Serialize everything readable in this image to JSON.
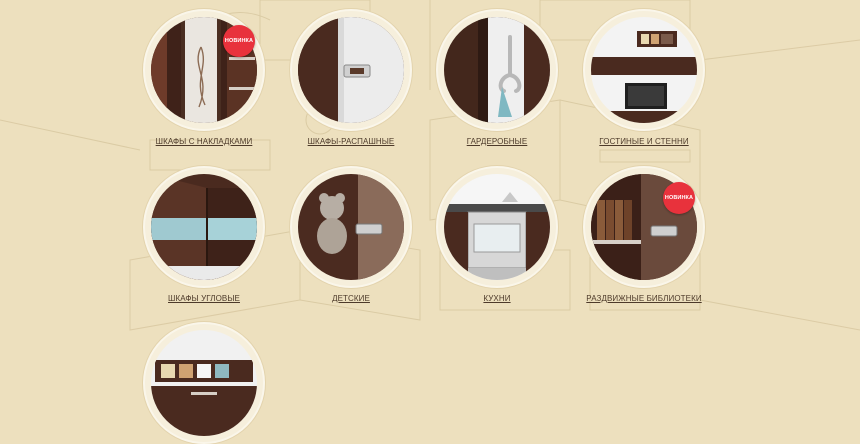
{
  "categories": [
    {
      "label": "ШКАФЫ С НАКЛАДКАМИ",
      "badge": "НОВИНКА"
    },
    {
      "label": "ШКАФЫ-РАСПАШНЫЕ",
      "badge": ""
    },
    {
      "label": "ГАРДЕРОБНЫЕ",
      "badge": ""
    },
    {
      "label": "ГОСТИНЫЕ И СТЕННИ",
      "badge": ""
    },
    {
      "label": "ШКАФЫ УГЛОВЫЕ",
      "badge": ""
    },
    {
      "label": "ДЕТСКИЕ",
      "badge": ""
    },
    {
      "label": "КУХНИ",
      "badge": ""
    },
    {
      "label": "РАЗДВИЖНЫЕ БИБЛИОТЕКИ",
      "badge": "НОВИНКА"
    },
    {
      "label": "",
      "badge": ""
    }
  ],
  "colors": {
    "background": "#ede0be",
    "wood": "#4a2e22",
    "badge": "#e8323c",
    "label": "#4d3a2a"
  }
}
